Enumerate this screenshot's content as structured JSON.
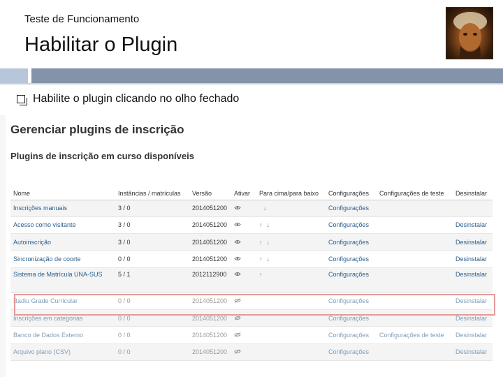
{
  "slide": {
    "subtitle": "Teste de Funcionamento",
    "title": "Habilitar o Plugin",
    "bullet": "Habilite o plugin clicando no olho fechado"
  },
  "screenshot": {
    "heading": "Gerenciar plugins de inscrição",
    "section": "Plugins de inscrição em curso disponíveis",
    "columns": {
      "name": "Nome",
      "instances": "Instâncias / matrículas",
      "version": "Versão",
      "enable": "Ativar",
      "updown": "Para cima/para baixo",
      "settings": "Configurações",
      "test_settings": "Configurações de teste",
      "uninstall": "Desinstalar"
    },
    "rows": [
      {
        "name": "Inscrições manuais",
        "instances": "3 / 0",
        "version": "2014051200",
        "eye": "eye-open-icon",
        "up": "",
        "down": "↓",
        "settings": "Configurações",
        "test": "",
        "uninstall": ""
      },
      {
        "name": "Acesso como visitante",
        "instances": "3 / 0",
        "version": "2014051200",
        "eye": "eye-open-icon",
        "up": "↑",
        "down": "↓",
        "settings": "Configurações",
        "test": "",
        "uninstall": "Desinstalar"
      },
      {
        "name": "Autoinscrição",
        "instances": "3 / 0",
        "version": "2014051200",
        "eye": "eye-open-icon",
        "up": "↑",
        "down": "↓",
        "settings": "Configurações",
        "test": "",
        "uninstall": "Desinstalar"
      },
      {
        "name": "Sincronização de coorte",
        "instances": "0 / 0",
        "version": "2014051200",
        "eye": "eye-open-icon",
        "up": "↑",
        "down": "↓",
        "settings": "Configurações",
        "test": "",
        "uninstall": "Desinstalar"
      },
      {
        "name": "Sistema de Matrícula UNA-SUS",
        "instances": "5 / 1",
        "version": "2012112900",
        "eye": "eye-open-icon",
        "up": "↑",
        "down": "",
        "settings": "Configurações",
        "test": "",
        "uninstall": "Desinstalar"
      },
      {
        "name": "Badiu Grade Curricular",
        "instances": "0 / 0",
        "version": "2014051200",
        "eye": "eye-closed-icon",
        "up": "",
        "down": "",
        "settings": "Configurações",
        "test": "",
        "uninstall": "Desinstalar"
      },
      {
        "name": "Inscrições em categorias",
        "instances": "0 / 0",
        "version": "2014051200",
        "eye": "eye-closed-icon",
        "up": "",
        "down": "",
        "settings": "Configurações",
        "test": "",
        "uninstall": "Desinstalar"
      },
      {
        "name": "Banco de Dados Externo",
        "instances": "0 / 0",
        "version": "2014051200",
        "eye": "eye-closed-icon",
        "up": "",
        "down": "",
        "settings": "Configurações",
        "test": "Configurações de teste",
        "uninstall": "Desinstalar"
      },
      {
        "name": "Arquivo plano (CSV)",
        "instances": "0 / 0",
        "version": "2014051200",
        "eye": "eye-closed-icon",
        "up": "",
        "down": "",
        "settings": "Configurações",
        "test": "",
        "uninstall": "Desinstalar"
      }
    ]
  },
  "colors": {
    "bar_light": "#b7c6d8",
    "bar_dark": "#8393a9",
    "link": "#2a5f8f",
    "highlight": "#e59a9a"
  }
}
